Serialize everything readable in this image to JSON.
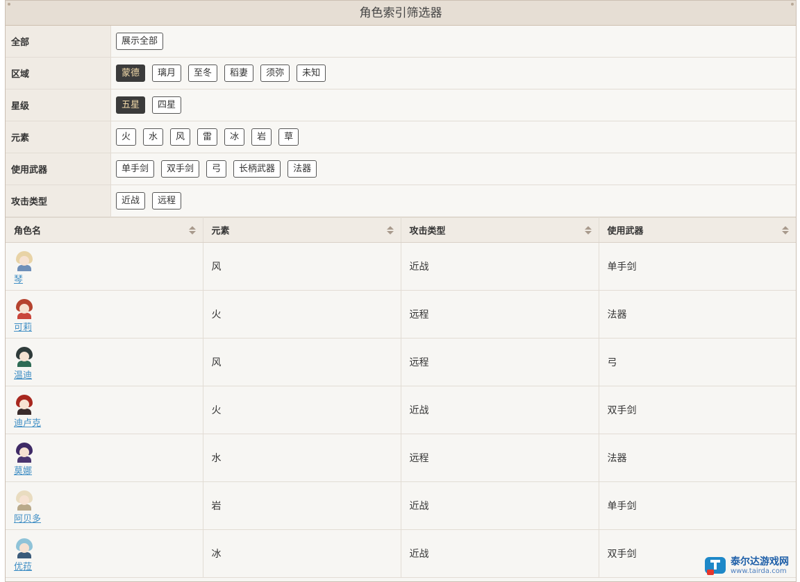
{
  "title": "角色索引筛选器",
  "filters": [
    {
      "label": "全部",
      "options": [
        {
          "text": "展示全部",
          "active": false
        }
      ]
    },
    {
      "label": "区域",
      "options": [
        {
          "text": "蒙德",
          "active": true
        },
        {
          "text": "璃月",
          "active": false
        },
        {
          "text": "至冬",
          "active": false
        },
        {
          "text": "稻妻",
          "active": false
        },
        {
          "text": "须弥",
          "active": false
        },
        {
          "text": "未知",
          "active": false
        }
      ]
    },
    {
      "label": "星级",
      "options": [
        {
          "text": "五星",
          "active": true
        },
        {
          "text": "四星",
          "active": false
        }
      ]
    },
    {
      "label": "元素",
      "options": [
        {
          "text": "火",
          "active": false
        },
        {
          "text": "水",
          "active": false
        },
        {
          "text": "风",
          "active": false
        },
        {
          "text": "雷",
          "active": false
        },
        {
          "text": "冰",
          "active": false
        },
        {
          "text": "岩",
          "active": false
        },
        {
          "text": "草",
          "active": false
        }
      ]
    },
    {
      "label": "使用武器",
      "options": [
        {
          "text": "单手剑",
          "active": false
        },
        {
          "text": "双手剑",
          "active": false
        },
        {
          "text": "弓",
          "active": false
        },
        {
          "text": "长柄武器",
          "active": false
        },
        {
          "text": "法器",
          "active": false
        }
      ]
    },
    {
      "label": "攻击类型",
      "options": [
        {
          "text": "近战",
          "active": false
        },
        {
          "text": "远程",
          "active": false
        }
      ]
    }
  ],
  "table": {
    "columns": [
      "角色名",
      "元素",
      "攻击类型",
      "使用武器"
    ],
    "rows": [
      {
        "name": "琴",
        "element": "风",
        "attack": "近战",
        "weapon": "单手剑",
        "avatar": {
          "hair": "#e8d3a6",
          "body": "#6f8fb8"
        }
      },
      {
        "name": "可莉",
        "element": "火",
        "attack": "远程",
        "weapon": "法器",
        "avatar": {
          "hair": "#b5432f",
          "body": "#c9453a"
        }
      },
      {
        "name": "温迪",
        "element": "风",
        "attack": "远程",
        "weapon": "弓",
        "avatar": {
          "hair": "#2f3b3a",
          "body": "#2e6b55"
        }
      },
      {
        "name": "迪卢克",
        "element": "火",
        "attack": "近战",
        "weapon": "双手剑",
        "avatar": {
          "hair": "#a8281f",
          "body": "#3a2b2b"
        }
      },
      {
        "name": "莫娜",
        "element": "水",
        "attack": "远程",
        "weapon": "法器",
        "avatar": {
          "hair": "#3e2a66",
          "body": "#4a3670"
        }
      },
      {
        "name": "阿贝多",
        "element": "岩",
        "attack": "近战",
        "weapon": "单手剑",
        "avatar": {
          "hair": "#e9dcc0",
          "body": "#b9a98a"
        }
      },
      {
        "name": "优菈",
        "element": "冰",
        "attack": "近战",
        "weapon": "双手剑",
        "avatar": {
          "hair": "#8fc3d8",
          "body": "#3b5b7a"
        }
      }
    ]
  },
  "watermark": {
    "name": "泰尔达游戏网",
    "url": "www.tairda.com"
  }
}
